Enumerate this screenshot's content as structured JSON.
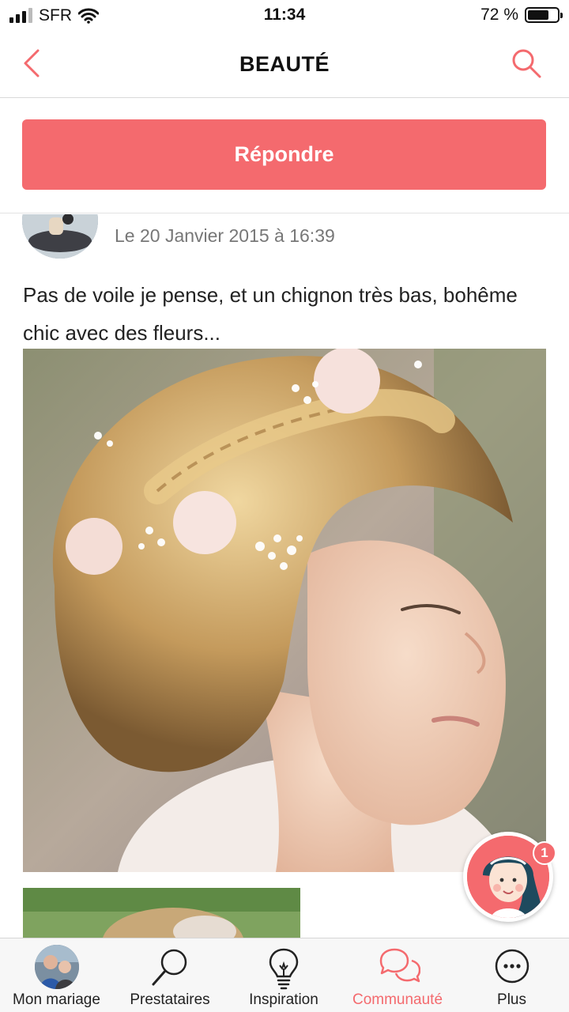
{
  "status": {
    "carrier": "SFR",
    "time": "11:34",
    "battery_text": "72 %",
    "battery_level": 0.72
  },
  "nav": {
    "title": "BEAUTÉ"
  },
  "reply": {
    "label": "Répondre"
  },
  "post": {
    "date": "Le 20 Janvier 2015 à 16:39",
    "text": "Pas de voile je pense, et un chignon très bas, bohême chic avec des fleurs..."
  },
  "fab": {
    "badge_count": "1"
  },
  "tabbar": {
    "items": [
      {
        "label": "Mon mariage",
        "icon": "avatar"
      },
      {
        "label": "Prestataires",
        "icon": "search-icon"
      },
      {
        "label": "Inspiration",
        "icon": "lightbulb-icon"
      },
      {
        "label": "Communauté",
        "icon": "chat-bubbles-icon",
        "active": true
      },
      {
        "label": "Plus",
        "icon": "more-icon"
      }
    ]
  },
  "colors": {
    "accent": "#f46a6e",
    "text": "#222222",
    "muted": "#777777"
  }
}
